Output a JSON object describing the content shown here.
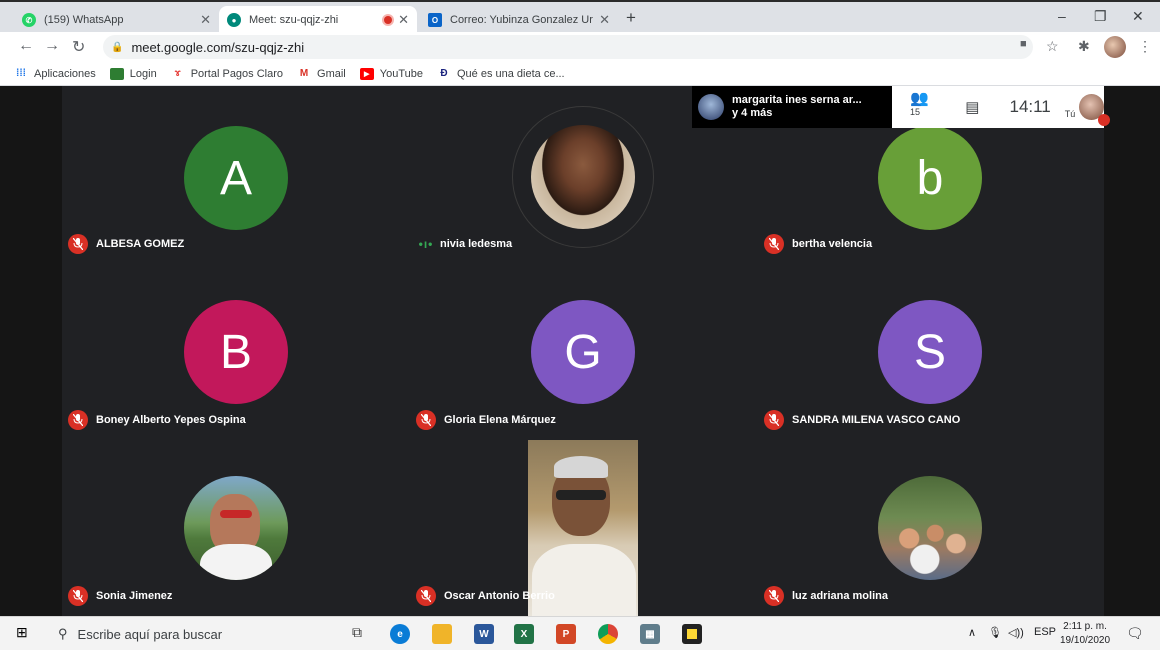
{
  "browser": {
    "tabs": [
      {
        "title": "(159) WhatsApp",
        "favicon": "whatsapp-icon",
        "color": "#25d366"
      },
      {
        "title": "Meet: szu-qqjz-zhi",
        "favicon": "meet-icon",
        "color": "#00897b",
        "recording": true
      },
      {
        "title": "Correo: Yubinza Gonzalez Uribe -",
        "favicon": "outlook-icon",
        "color": "#0a64c8"
      }
    ],
    "new_tab": "+",
    "url": "meet.google.com/szu-qqjz-zhi",
    "bookmarks": [
      {
        "label": "Aplicaciones",
        "icon": "apps-grid-icon"
      },
      {
        "label": "Login",
        "icon": "login-icon"
      },
      {
        "label": "Portal Pagos Claro",
        "icon": "claro-icon"
      },
      {
        "label": "Gmail",
        "icon": "gmail-icon"
      },
      {
        "label": "YouTube",
        "icon": "youtube-icon"
      },
      {
        "label": "Qué es una dieta ce...",
        "icon": "article-icon"
      }
    ]
  },
  "meet": {
    "presenter": {
      "line1": "margarita ines serna ar...",
      "line2": "y 4 más"
    },
    "participant_count": "15",
    "time": "14:11",
    "self_label": "Tú",
    "participants": [
      {
        "name": "ALBESA GOMEZ",
        "initial": "A",
        "color": "#2e7d32",
        "muted": true
      },
      {
        "name": "nivia ledesma",
        "initial": "",
        "color": "",
        "muted": false
      },
      {
        "name": "bertha velencia",
        "initial": "b",
        "color": "#689f38",
        "muted": true
      },
      {
        "name": "Boney Alberto Yepes Ospina",
        "initial": "B",
        "color": "#c2185b",
        "muted": true
      },
      {
        "name": "Gloria Elena Márquez",
        "initial": "G",
        "color": "#7e57c2",
        "muted": true
      },
      {
        "name": "SANDRA MILENA VASCO CANO",
        "initial": "S",
        "color": "#7e57c2",
        "muted": true
      },
      {
        "name": "Sonia Jimenez",
        "initial": "",
        "color": "",
        "muted": true
      },
      {
        "name": "Oscar Antonio Berrio",
        "initial": "",
        "color": "",
        "muted": true
      },
      {
        "name": "luz adriana molina",
        "initial": "",
        "color": "",
        "muted": true
      }
    ]
  },
  "taskbar": {
    "search_placeholder": "Escribe aquí para buscar",
    "language": "ESP",
    "time": "2:11 p. m.",
    "date": "19/10/2020"
  }
}
